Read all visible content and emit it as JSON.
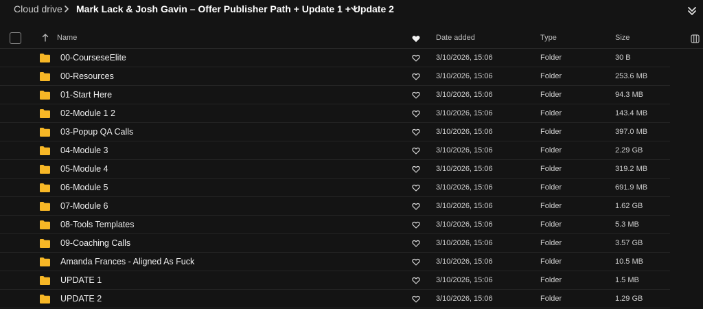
{
  "breadcrumb": {
    "root": "Cloud drive",
    "current": "Mark Lack & Josh Gavin – Offer Publisher Path + Update 1 + Update 2"
  },
  "table": {
    "columns": {
      "name": "Name",
      "date": "Date added",
      "type": "Type",
      "size": "Size"
    },
    "rows": [
      {
        "name": "00-CourseseElite",
        "date": "3/10/2026, 15:06",
        "type": "Folder",
        "size": "30 B"
      },
      {
        "name": "00-Resources",
        "date": "3/10/2026, 15:06",
        "type": "Folder",
        "size": "253.6 MB"
      },
      {
        "name": "01-Start Here",
        "date": "3/10/2026, 15:06",
        "type": "Folder",
        "size": "94.3 MB"
      },
      {
        "name": "02-Module 1 2",
        "date": "3/10/2026, 15:06",
        "type": "Folder",
        "size": "143.4 MB"
      },
      {
        "name": "03-Popup QA Calls",
        "date": "3/10/2026, 15:06",
        "type": "Folder",
        "size": "397.0 MB"
      },
      {
        "name": "04-Module 3",
        "date": "3/10/2026, 15:06",
        "type": "Folder",
        "size": "2.29 GB"
      },
      {
        "name": "05-Module 4",
        "date": "3/10/2026, 15:06",
        "type": "Folder",
        "size": "319.2 MB"
      },
      {
        "name": "06-Module 5",
        "date": "3/10/2026, 15:06",
        "type": "Folder",
        "size": "691.9 MB"
      },
      {
        "name": "07-Module 6",
        "date": "3/10/2026, 15:06",
        "type": "Folder",
        "size": "1.62 GB"
      },
      {
        "name": "08-Tools Templates",
        "date": "3/10/2026, 15:06",
        "type": "Folder",
        "size": "5.3 MB"
      },
      {
        "name": "09-Coaching Calls",
        "date": "3/10/2026, 15:06",
        "type": "Folder",
        "size": "3.57 GB"
      },
      {
        "name": "Amanda Frances - Aligned As Fuck",
        "date": "3/10/2026, 15:06",
        "type": "Folder",
        "size": "10.5 MB"
      },
      {
        "name": "UPDATE 1",
        "date": "3/10/2026, 15:06",
        "type": "Folder",
        "size": "1.5 MB"
      },
      {
        "name": "UPDATE 2",
        "date": "3/10/2026, 15:06",
        "type": "Folder",
        "size": "1.29 GB"
      }
    ]
  },
  "icons": {
    "folder": "folder-icon",
    "heart": "heart-icon",
    "sort": "sort-ascending-icon",
    "chevron": "chevron-right-icon",
    "dropdown": "chevron-down-icon",
    "collapse": "double-chevron-down-icon",
    "columns": "columns-icon"
  },
  "colors": {
    "background": "#141414",
    "folder": "#f7b726",
    "text": "#efefef",
    "muted": "#cfcfcf"
  }
}
